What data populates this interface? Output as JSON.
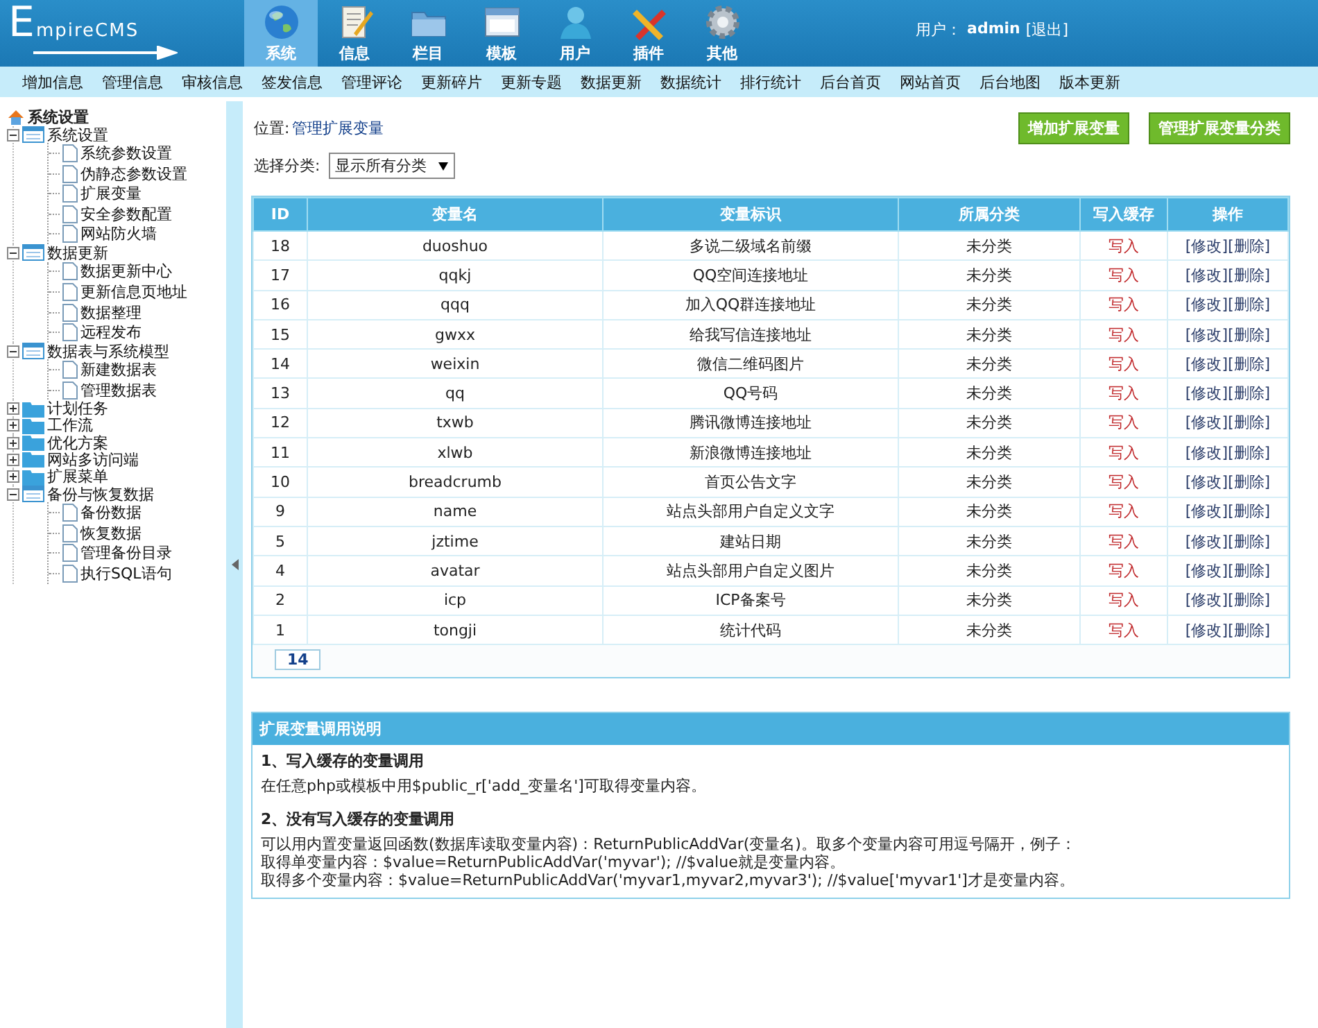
{
  "header": {
    "logo": "EmpireCMS",
    "user_label": "用户：",
    "user_name": "admin",
    "logout": "[退出]"
  },
  "tabs": [
    {
      "label": "系统",
      "selected": true
    },
    {
      "label": "信息",
      "selected": false
    },
    {
      "label": "栏目",
      "selected": false
    },
    {
      "label": "模板",
      "selected": false
    },
    {
      "label": "用户",
      "selected": false
    },
    {
      "label": "插件",
      "selected": false
    },
    {
      "label": "其他",
      "selected": false
    }
  ],
  "subnav": [
    "增加信息",
    "管理信息",
    "审核信息",
    "签发信息",
    "管理评论",
    "更新碎片",
    "更新专题",
    "数据更新",
    "数据统计",
    "排行统计",
    "后台首页",
    "网站首页",
    "后台地图",
    "版本更新"
  ],
  "sidebar": {
    "title": "系统设置",
    "items": [
      {
        "label": "系统设置",
        "expanded": true,
        "children": [
          {
            "label": "系统参数设置"
          },
          {
            "label": "伪静态参数设置"
          },
          {
            "label": "扩展变量"
          },
          {
            "label": "安全参数配置"
          },
          {
            "label": "网站防火墙"
          }
        ]
      },
      {
        "label": "数据更新",
        "expanded": true,
        "children": [
          {
            "label": "数据更新中心"
          },
          {
            "label": "更新信息页地址"
          },
          {
            "label": "数据整理"
          },
          {
            "label": "远程发布"
          }
        ]
      },
      {
        "label": "数据表与系统模型",
        "expanded": true,
        "children": [
          {
            "label": "新建数据表"
          },
          {
            "label": "管理数据表"
          }
        ]
      },
      {
        "label": "计划任务",
        "expanded": false
      },
      {
        "label": "工作流",
        "expanded": false
      },
      {
        "label": "优化方案",
        "expanded": false
      },
      {
        "label": "网站多访问端",
        "expanded": false
      },
      {
        "label": "扩展菜单",
        "expanded": false
      },
      {
        "label": "备份与恢复数据",
        "expanded": true,
        "children": [
          {
            "label": "备份数据"
          },
          {
            "label": "恢复数据"
          },
          {
            "label": "管理备份目录"
          },
          {
            "label": "执行SQL语句"
          }
        ]
      }
    ]
  },
  "location": {
    "label": "位置:",
    "link": "管理扩展变量"
  },
  "buttons": [
    "增加扩展变量",
    "管理扩展变量分类"
  ],
  "filter": {
    "label": "选择分类:",
    "value": "显示所有分类"
  },
  "table": {
    "columns": [
      "ID",
      "变量名",
      "变量标识",
      "所属分类",
      "写入缓存",
      "操作"
    ],
    "rows": [
      {
        "id": "18",
        "name": "duoshuo",
        "label": "多说二级域名前缀",
        "category": "未分类",
        "cache": "写入",
        "edit": "[修改]",
        "delete": "[删除]"
      },
      {
        "id": "17",
        "name": "qqkj",
        "label": "QQ空间连接地址",
        "category": "未分类",
        "cache": "写入",
        "edit": "[修改]",
        "delete": "[删除]"
      },
      {
        "id": "16",
        "name": "qqq",
        "label": "加入QQ群连接地址",
        "category": "未分类",
        "cache": "写入",
        "edit": "[修改]",
        "delete": "[删除]"
      },
      {
        "id": "15",
        "name": "gwxx",
        "label": "给我写信连接地址",
        "category": "未分类",
        "cache": "写入",
        "edit": "[修改]",
        "delete": "[删除]"
      },
      {
        "id": "14",
        "name": "weixin",
        "label": "微信二维码图片",
        "category": "未分类",
        "cache": "写入",
        "edit": "[修改]",
        "delete": "[删除]"
      },
      {
        "id": "13",
        "name": "qq",
        "label": "QQ号码",
        "category": "未分类",
        "cache": "写入",
        "edit": "[修改]",
        "delete": "[删除]"
      },
      {
        "id": "12",
        "name": "txwb",
        "label": "腾讯微博连接地址",
        "category": "未分类",
        "cache": "写入",
        "edit": "[修改]",
        "delete": "[删除]"
      },
      {
        "id": "11",
        "name": "xlwb",
        "label": "新浪微博连接地址",
        "category": "未分类",
        "cache": "写入",
        "edit": "[修改]",
        "delete": "[删除]"
      },
      {
        "id": "10",
        "name": "breadcrumb",
        "label": "首页公告文字",
        "category": "未分类",
        "cache": "写入",
        "edit": "[修改]",
        "delete": "[删除]"
      },
      {
        "id": "9",
        "name": "name",
        "label": "站点头部用户自定义文字",
        "category": "未分类",
        "cache": "写入",
        "edit": "[修改]",
        "delete": "[删除]"
      },
      {
        "id": "5",
        "name": "jztime",
        "label": "建站日期",
        "category": "未分类",
        "cache": "写入",
        "edit": "[修改]",
        "delete": "[删除]"
      },
      {
        "id": "4",
        "name": "avatar",
        "label": "站点头部用户自定义图片",
        "category": "未分类",
        "cache": "写入",
        "edit": "[修改]",
        "delete": "[删除]"
      },
      {
        "id": "2",
        "name": "icp",
        "label": "ICP备案号",
        "category": "未分类",
        "cache": "写入",
        "edit": "[修改]",
        "delete": "[删除]"
      },
      {
        "id": "1",
        "name": "tongji",
        "label": "统计代码",
        "category": "未分类",
        "cache": "写入",
        "edit": "[修改]",
        "delete": "[删除]"
      }
    ],
    "total": "14"
  },
  "notes": {
    "title": "扩展变量调用说明",
    "sections": [
      {
        "heading": "1、写入缓存的变量调用",
        "lines": [
          "在任意php或模板中用$public_r['add_变量名']可取得变量内容。"
        ]
      },
      {
        "heading": "2、没有写入缓存的变量调用",
        "lines": [
          "可以用内置变量返回函数(数据库读取变量内容)：ReturnPublicAddVar(变量名)。取多个变量内容可用逗号隔开，例子：",
          "取得单变量内容：$value=ReturnPublicAddVar('myvar'); //$value就是变量内容。",
          "取得多个变量内容：$value=ReturnPublicAddVar('myvar1,myvar2,myvar3'); //$value['myvar1']才是变量内容。"
        ]
      }
    ]
  }
}
